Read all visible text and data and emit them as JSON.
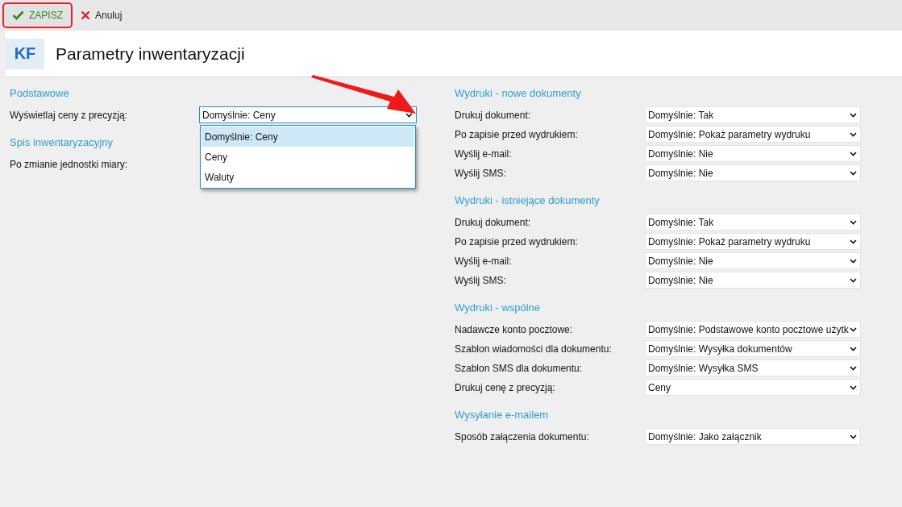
{
  "toolbar": {
    "buttons": [
      {
        "kind": "save",
        "label": "ZAPISZ",
        "highlighted": true
      },
      {
        "kind": "cancel",
        "label": "Anuluj",
        "highlighted": false
      }
    ]
  },
  "header": {
    "badge": "KF",
    "title": "Parametry inwentaryzacji"
  },
  "left_sections": [
    {
      "title": "Podstawowe",
      "rows": [
        {
          "label": "Wyświetlaj ceny z precyzją:",
          "value": "Domyślnie: Ceny",
          "open": true,
          "options": [
            {
              "label": "Domyślnie: Ceny",
              "selected": true
            },
            {
              "label": "Ceny",
              "selected": false
            },
            {
              "label": "Waluty",
              "selected": false
            }
          ]
        }
      ]
    },
    {
      "title": "Spis inwentaryzacyjny",
      "rows": [
        {
          "label": "Po zmianie jednostki miary:"
        }
      ]
    }
  ],
  "right_sections": [
    {
      "title": "Wydruki - nowe dokumenty",
      "rows": [
        {
          "label": "Drukuj dokument:",
          "value": "Domyślnie: Tak"
        },
        {
          "label": "Po zapisie przed wydrukiem:",
          "value": "Domyślnie: Pokaż parametry wydruku"
        },
        {
          "label": "Wyślij e-mail:",
          "value": "Domyślnie: Nie"
        },
        {
          "label": "Wyślij SMS:",
          "value": "Domyślnie: Nie"
        }
      ]
    },
    {
      "title": "Wydruki - istniejące dokumenty",
      "rows": [
        {
          "label": "Drukuj dokument:",
          "value": "Domyślnie: Tak"
        },
        {
          "label": "Po zapisie przed wydrukiem:",
          "value": "Domyślnie: Pokaż parametry wydruku"
        },
        {
          "label": "Wyślij e-mail:",
          "value": "Domyślnie: Nie"
        },
        {
          "label": "Wyślij SMS:",
          "value": "Domyślnie: Nie"
        }
      ]
    },
    {
      "title": "Wydruki - wspólne",
      "rows": [
        {
          "label": "Nadawcze konto pocztowe:",
          "value": "Domyślnie: Podstawowe konto pocztowe użytk"
        },
        {
          "label": "Szablon wiadomości dla dokumentu:",
          "value": "Domyślnie: Wysyłka dokumentów"
        },
        {
          "label": "Szablon SMS dla dokumentu:",
          "value": "Domyślnie: Wysyłka SMS"
        },
        {
          "label": "Drukuj cenę z precyzją:",
          "value": "Ceny"
        }
      ]
    },
    {
      "title": "Wysyłanie e-mailem",
      "rows": [
        {
          "label": "Sposób załączenia dokumentu:",
          "value": "Domyślnie: Jako załącznik"
        }
      ]
    }
  ]
}
